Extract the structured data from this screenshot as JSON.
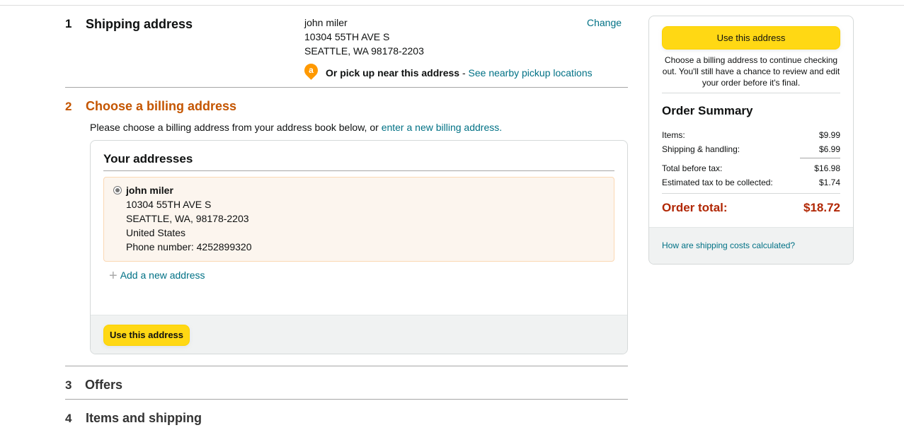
{
  "steps": {
    "s1": {
      "num": "1",
      "title": "Shipping address"
    },
    "s2": {
      "num": "2",
      "title": "Choose a billing address"
    },
    "s3": {
      "num": "3",
      "title": "Offers"
    },
    "s4": {
      "num": "4",
      "title": "Items and shipping"
    }
  },
  "shipping": {
    "name": "john miler",
    "line1": "10304 55TH AVE S",
    "line2": "SEATTLE, WA 98178-2203",
    "change": "Change",
    "pickup_icon_letter": "a",
    "pickup_bold": "Or pick up near this address",
    "pickup_sep": " - ",
    "pickup_link": "See nearby pickup locations"
  },
  "billing": {
    "intro": "Please choose a billing address from your address book below, or ",
    "intro_link": "enter a new billing address.",
    "panel_title": "Your addresses",
    "address": {
      "name": "john miler",
      "line1": "10304 55TH AVE S",
      "line2": "SEATTLE, WA, 98178-2203",
      "country": "United States",
      "phone": "Phone number: 4252899320"
    },
    "add_new": "Add a new address",
    "use_button": "Use this address"
  },
  "summary": {
    "use_button": "Use this address",
    "note": "Choose a billing address to continue checking out. You'll still have a chance to review and edit your order before it's final.",
    "title": "Order Summary",
    "rows": [
      {
        "label": "Items:",
        "value": "$9.99"
      },
      {
        "label": "Shipping & handling:",
        "value": "$6.99"
      },
      {
        "label": "Total before tax:",
        "value": "$16.98"
      },
      {
        "label": "Estimated tax to be collected:",
        "value": "$1.74"
      }
    ],
    "total_label": "Order total:",
    "total_value": "$18.72",
    "shipping_link": "How are shipping costs calculated?"
  },
  "colors": {
    "accent_orange": "#c45500",
    "button_yellow": "#ffd814",
    "link_teal": "#007185",
    "total_red": "#b12704"
  }
}
